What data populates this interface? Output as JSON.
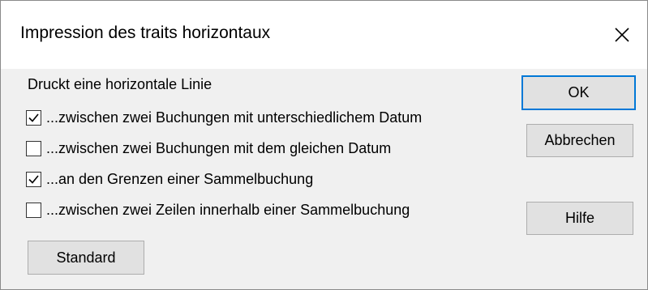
{
  "window": {
    "title": "Impression des traits horizontaux"
  },
  "group_label": "Druckt eine horizontale Linie",
  "options": [
    {
      "label": "...zwischen zwei Buchungen mit unterschiedlichem Datum",
      "checked": true
    },
    {
      "label": "...zwischen zwei Buchungen mit dem gleichen Datum",
      "checked": false
    },
    {
      "label": "...an den Grenzen einer Sammelbuchung",
      "checked": true
    },
    {
      "label": "...zwischen zwei Zeilen innerhalb einer Sammelbuchung",
      "checked": false
    }
  ],
  "buttons": {
    "ok": "OK",
    "cancel": "Abbrechen",
    "help": "Hilfe",
    "standard": "Standard"
  },
  "colors": {
    "accent": "#0078d7",
    "button_face": "#e1e1e1",
    "dialog_bg": "#f0f0f0",
    "titlebar_bg": "#ffffff"
  },
  "icons": {
    "close": "close-icon",
    "check": "checkmark-icon"
  }
}
